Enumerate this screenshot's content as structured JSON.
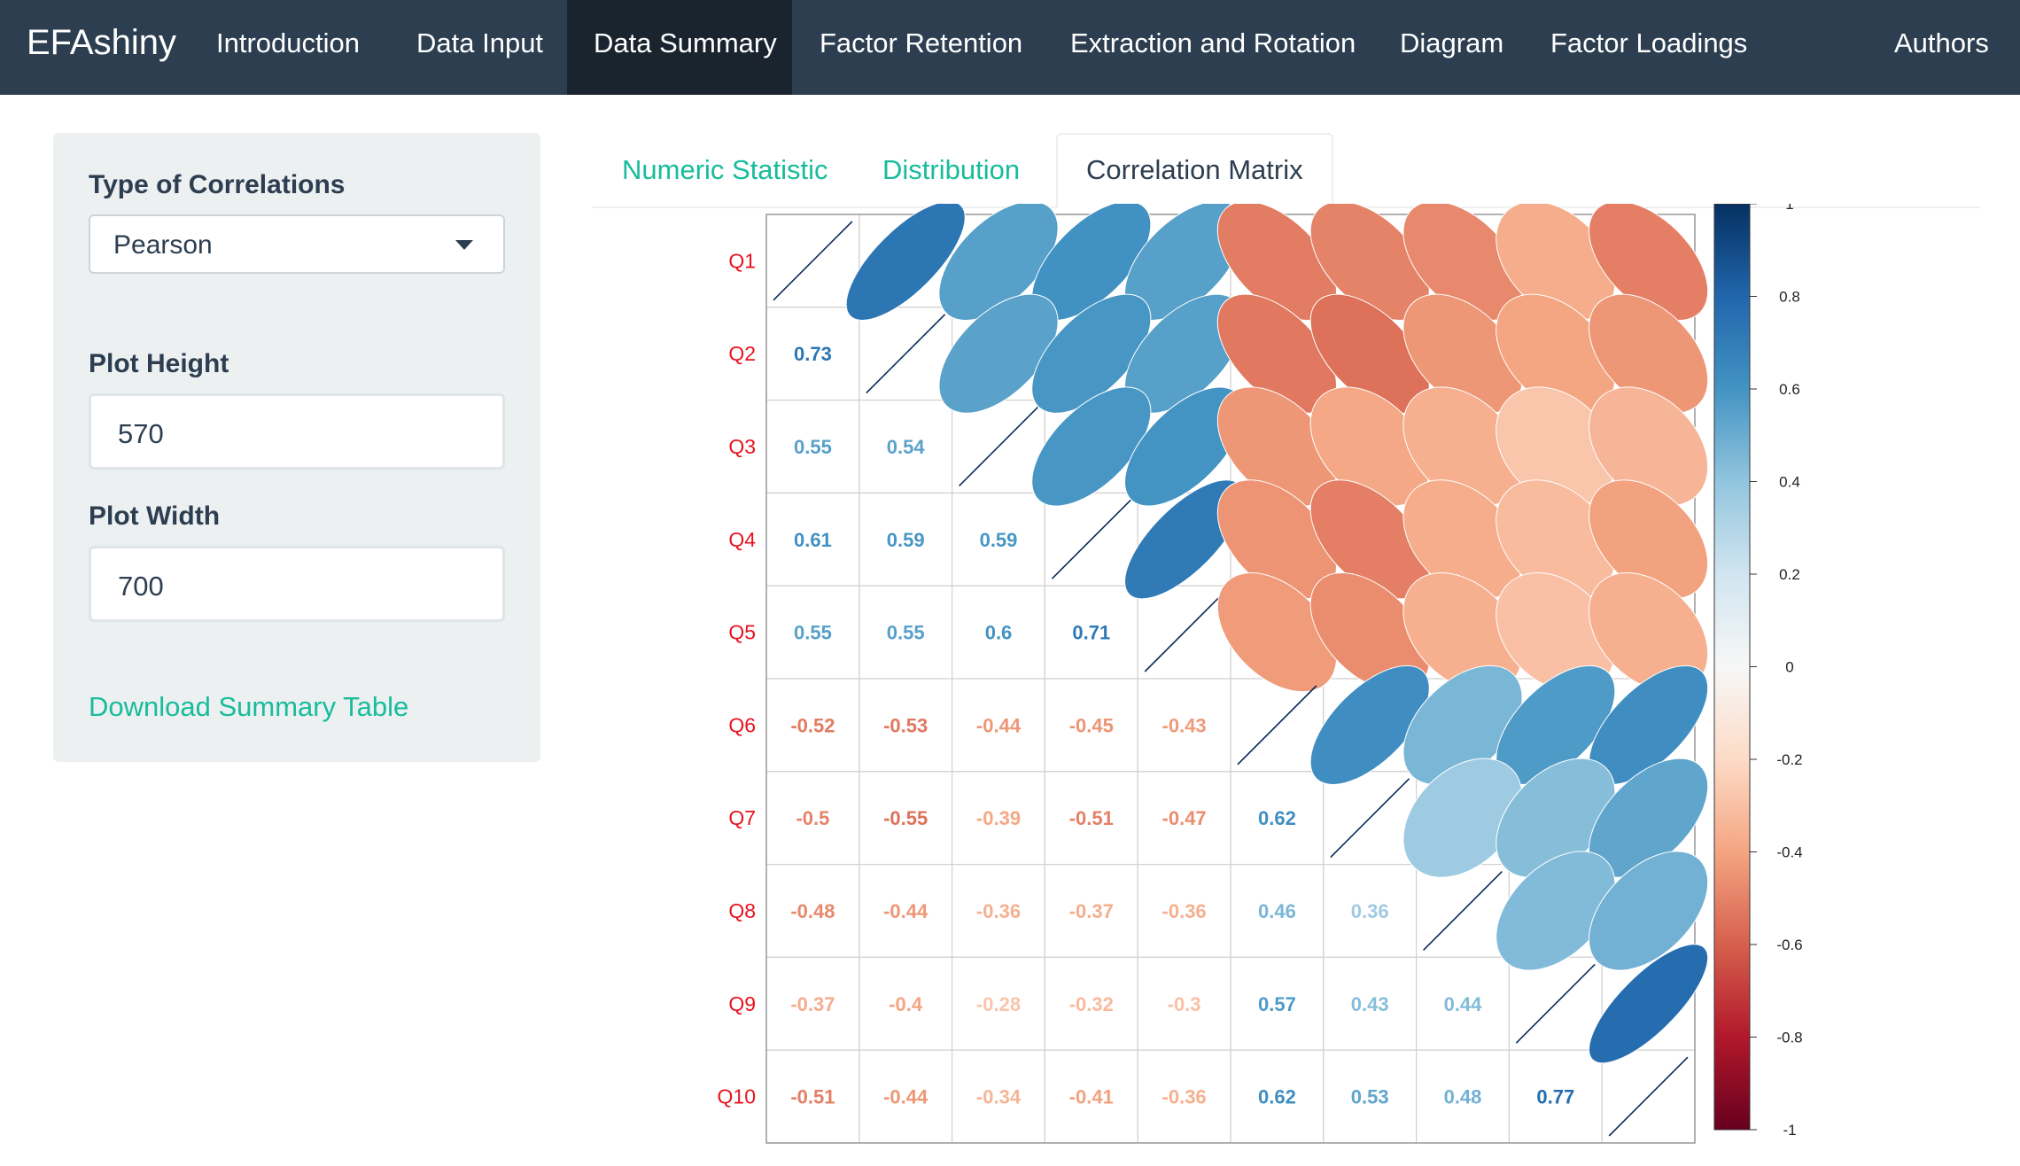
{
  "navbar": {
    "brand": "EFAshiny",
    "items": [
      {
        "label": "Introduction",
        "active": false
      },
      {
        "label": "Data Input",
        "active": false
      },
      {
        "label": "Data Summary",
        "active": true
      },
      {
        "label": "Factor Retention",
        "active": false
      },
      {
        "label": "Extraction and Rotation",
        "active": false
      },
      {
        "label": "Diagram",
        "active": false
      },
      {
        "label": "Factor Loadings",
        "active": false
      }
    ],
    "authors": "Authors"
  },
  "sidebar": {
    "correlation_label": "Type of Correlations",
    "correlation_value": "Pearson",
    "height_label": "Plot Height",
    "height_value": "570",
    "width_label": "Plot Width",
    "width_value": "700",
    "download_label": "Download Summary Table"
  },
  "tabs": [
    {
      "label": "Numeric Statistic",
      "active": false
    },
    {
      "label": "Distribution",
      "active": false
    },
    {
      "label": "Correlation Matrix",
      "active": true
    }
  ],
  "chart_data": {
    "type": "heatmap",
    "variables": [
      "Q1",
      "Q2",
      "Q3",
      "Q4",
      "Q5",
      "Q6",
      "Q7",
      "Q8",
      "Q9",
      "Q10"
    ],
    "matrix": [
      [
        1,
        0.73,
        0.55,
        0.61,
        0.55,
        -0.52,
        -0.5,
        -0.48,
        -0.37,
        -0.51
      ],
      [
        0.73,
        1,
        0.54,
        0.59,
        0.55,
        -0.53,
        -0.55,
        -0.44,
        -0.4,
        -0.44
      ],
      [
        0.55,
        0.54,
        1,
        0.59,
        0.6,
        -0.44,
        -0.39,
        -0.36,
        -0.28,
        -0.34
      ],
      [
        0.61,
        0.59,
        0.59,
        1,
        0.71,
        -0.45,
        -0.51,
        -0.37,
        -0.32,
        -0.41
      ],
      [
        0.55,
        0.55,
        0.6,
        0.71,
        1,
        -0.43,
        -0.47,
        -0.36,
        -0.3,
        -0.36
      ],
      [
        -0.52,
        -0.53,
        -0.44,
        -0.45,
        -0.43,
        1,
        0.62,
        0.46,
        0.57,
        0.62
      ],
      [
        -0.5,
        -0.55,
        -0.39,
        -0.51,
        -0.47,
        0.62,
        1,
        0.36,
        0.43,
        0.53
      ],
      [
        -0.48,
        -0.44,
        -0.36,
        -0.37,
        -0.36,
        0.46,
        0.36,
        1,
        0.44,
        0.48
      ],
      [
        -0.37,
        -0.4,
        -0.28,
        -0.32,
        -0.3,
        0.57,
        0.43,
        0.44,
        1,
        0.77
      ],
      [
        -0.51,
        -0.44,
        -0.34,
        -0.41,
        -0.36,
        0.62,
        0.53,
        0.48,
        0.77,
        1
      ]
    ],
    "lower_triangle": "numbers",
    "upper_triangle": "ellipses",
    "colorbar_ticks": [
      "1",
      "0.8",
      "0.6",
      "0.4",
      "0.2",
      "0",
      "-0.2",
      "-0.4",
      "-0.6",
      "-0.8",
      "-1"
    ],
    "color_scale": [
      "#67001f",
      "#b2182b",
      "#d6604d",
      "#f4a582",
      "#fddbc7",
      "#f7f7f7",
      "#d1e5f0",
      "#92c5de",
      "#4393c3",
      "#2166ac",
      "#053061"
    ],
    "label_color": "#e8121f"
  },
  "colors": {
    "navbar_bg": "#2c3e50",
    "navbar_active_bg": "#1a242f",
    "sidebar_bg": "#ecf0f1",
    "accent": "#18bc9c"
  }
}
